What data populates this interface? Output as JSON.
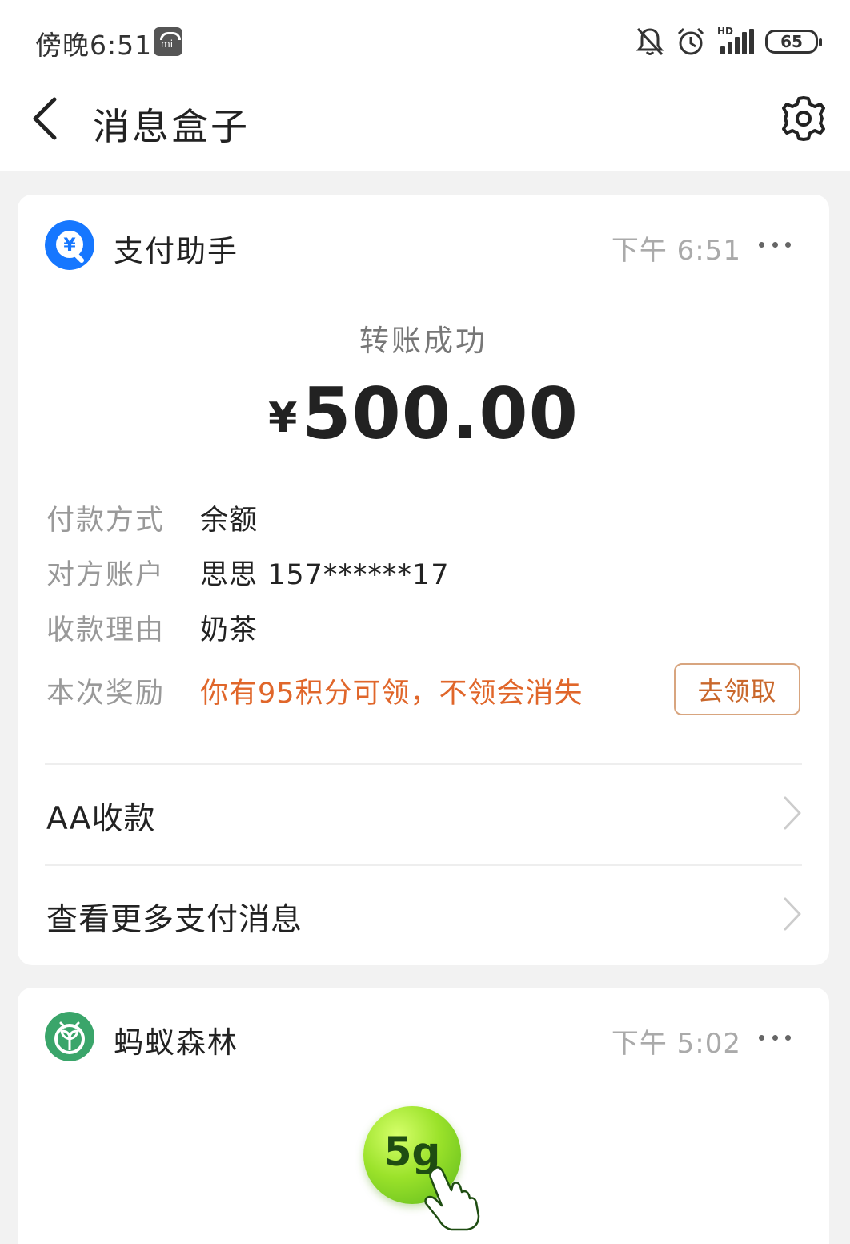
{
  "status_bar": {
    "time": "傍晚6:51",
    "battery": "65",
    "network": "HD"
  },
  "nav": {
    "title": "消息盒子"
  },
  "card_payment": {
    "app_name": "支付助手",
    "time": "下午 6:51",
    "title": "转账成功",
    "currency": "¥",
    "amount": "500.00",
    "details": [
      {
        "label": "付款方式",
        "value": "余额"
      },
      {
        "label": "对方账户",
        "value": "思思 157******17"
      },
      {
        "label": "收款理由",
        "value": "奶茶"
      },
      {
        "label": "本次奖励",
        "value": "你有95积分可领，不领会消失"
      }
    ],
    "claim_button": "去领取",
    "links": [
      "AA收款",
      "查看更多支付消息"
    ]
  },
  "card_forest": {
    "app_name": "蚂蚁森林",
    "time": "下午 5:02",
    "energy": "5g"
  },
  "colors": {
    "accent_orange": "#e0662a",
    "alipay_blue": "#1677ff",
    "forest_green": "#3aa56a"
  }
}
